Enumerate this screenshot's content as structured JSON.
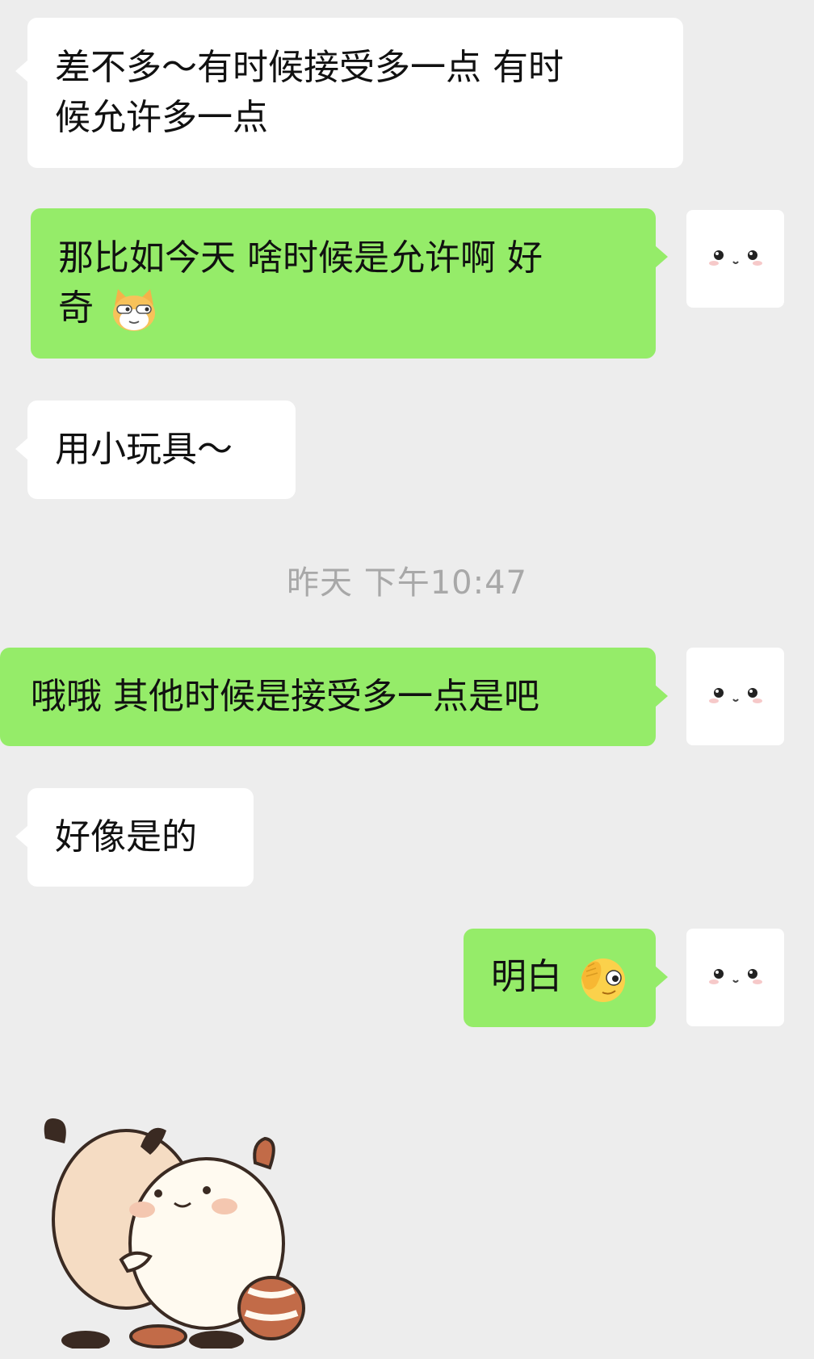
{
  "chat": {
    "messages": [
      {
        "side": "left",
        "text_lines": [
          "差不多～有时候接受多一点 有时",
          "候允许多一点"
        ]
      },
      {
        "side": "right",
        "text_lines": [
          "那比如今天 啥时候是允许啊 好",
          "奇"
        ],
        "emoji": "cat-emoji"
      },
      {
        "side": "left",
        "text": "用小玩具～"
      },
      {
        "side": "right",
        "text": "哦哦 其他时候是接受多一点是吧"
      },
      {
        "side": "left",
        "text": "好像是的"
      },
      {
        "side": "right",
        "text": "明白",
        "emoji": "facepalm-peek-emoji"
      }
    ],
    "timestamp": "昨天 下午10:47",
    "avatar_icon": "cute-face-avatar",
    "sticker_icon": "hugging-raccoons-sticker"
  },
  "colors": {
    "background": "#ededed",
    "incoming_bubble": "#ffffff",
    "outgoing_bubble": "#95ec69",
    "timestamp_text": "#a8a8a8"
  }
}
